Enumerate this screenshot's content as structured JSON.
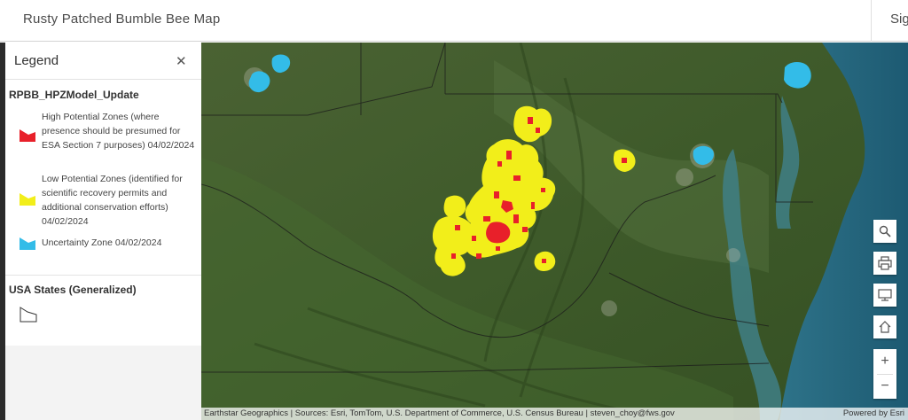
{
  "header": {
    "title": "Rusty Patched Bumble Bee Map",
    "signin_label": "Sign In"
  },
  "legend": {
    "title": "Legend",
    "close_icon": "close-icon",
    "layers": [
      {
        "name": "RPBB_HPZModel_Update",
        "items": [
          {
            "label": "High Potential Zones (where presence should be presumed for ESA Section 7 purposes) 04/02/2024",
            "color": "#e8202a"
          },
          {
            "label": "Low Potential Zones (identified for scientific recovery permits and additional conservation efforts) 04/02/2024",
            "color": "#f2ee1a"
          },
          {
            "label": "Uncertainty Zone 04/02/2024",
            "color": "#33bce8"
          }
        ]
      },
      {
        "name": "USA States (Generalized)",
        "symbol": "state-outline-icon"
      }
    ]
  },
  "map": {
    "attribution": "Earthstar Geographics | Sources: Esri, TomTom, U.S. Department of Commerce, U.S. Census Bureau | steven_choy@fws.gov",
    "powered_by": "Powered by Esri",
    "controls": [
      "search-icon",
      "print-icon",
      "monitor-icon",
      "home-icon",
      "zoom-in-button",
      "zoom-out-button"
    ],
    "zoom_in_label": "+",
    "zoom_out_label": "−",
    "colors": {
      "high_potential": "#e8202a",
      "low_potential": "#f2ee1a",
      "uncertainty": "#33bce8",
      "water": "#2d6f86",
      "land": "#3f5a2c"
    }
  }
}
